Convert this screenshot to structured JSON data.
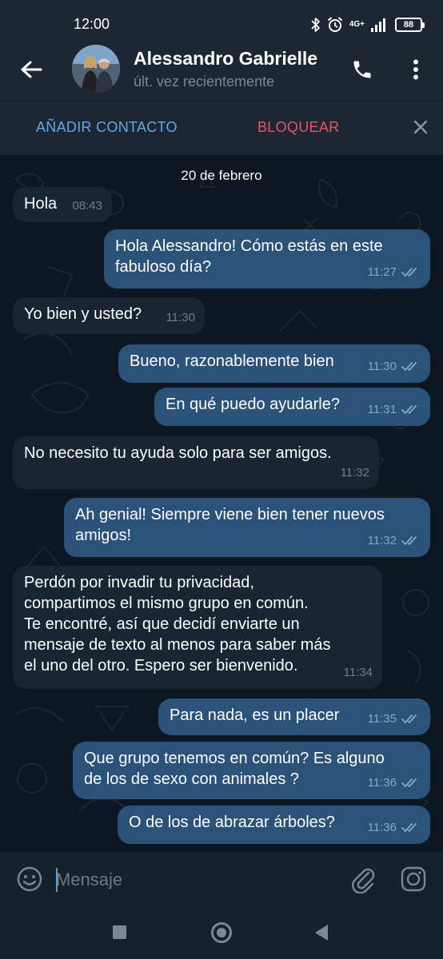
{
  "status_bar": {
    "time": "12:00",
    "network": "4G+",
    "battery": "88"
  },
  "header": {
    "contact_name": "Alessandro Gabrielle",
    "contact_status": "últ. vez recientemente"
  },
  "action_bar": {
    "add_contact": "AÑADIR CONTACTO",
    "block": "BLOQUEAR"
  },
  "chat": {
    "date": "20 de febrero",
    "messages": [
      {
        "direction": "in",
        "lines": [
          "Hola"
        ],
        "time": "08:43"
      },
      {
        "direction": "out",
        "lines": [
          "Hola Alessandro! Cómo estás en este",
          "fabuloso día?"
        ],
        "time": "11:27",
        "read": true
      },
      {
        "direction": "in",
        "lines": [
          "Yo bien y usted?"
        ],
        "time": "11:30"
      },
      {
        "direction": "out",
        "lines": [
          "Bueno, razonablemente bien"
        ],
        "time": "11:30",
        "read": true
      },
      {
        "direction": "out",
        "lines": [
          "En qué puedo ayudarle?"
        ],
        "time": "11:31",
        "read": true
      },
      {
        "direction": "in",
        "lines": [
          "No necesito tu ayuda solo para ser amigos."
        ],
        "time": "11:32"
      },
      {
        "direction": "out",
        "lines": [
          "Ah genial! Siempre viene bien tener nuevos",
          "amigos!"
        ],
        "time": "11:32",
        "read": true
      },
      {
        "direction": "in",
        "lines": [
          "Perdón por invadir tu privacidad,",
          "compartimos el mismo grupo en común.",
          "Te encontré, así que decidí enviarte un",
          "mensaje de texto al menos para saber más",
          "el uno del otro. Espero ser bienvenido."
        ],
        "time": "11:34"
      },
      {
        "direction": "out",
        "lines": [
          "Para nada, es un placer"
        ],
        "time": "11:35",
        "read": true
      },
      {
        "direction": "out",
        "lines": [
          "Que grupo tenemos en común? Es alguno",
          "de los de sexo con animales ?"
        ],
        "time": "11:36",
        "read": true
      },
      {
        "direction": "out",
        "lines": [
          "O de los de abrazar árboles?"
        ],
        "time": "11:36",
        "read": true
      }
    ]
  },
  "input": {
    "placeholder": "Mensaje"
  },
  "icons": {
    "back": "arrow-left-icon",
    "call": "phone-icon",
    "menu": "more-vertical-icon",
    "close": "close-icon",
    "emoji": "smiley-icon",
    "attach": "paperclip-icon",
    "camera": "instagram-camera-icon"
  },
  "colors": {
    "background": "#0e1621",
    "header": "#1d2733",
    "incoming_bubble": "#182533",
    "outgoing_bubble": "#2b5278",
    "accent_blue": "#63a8e5",
    "accent_red": "#e5585f"
  }
}
